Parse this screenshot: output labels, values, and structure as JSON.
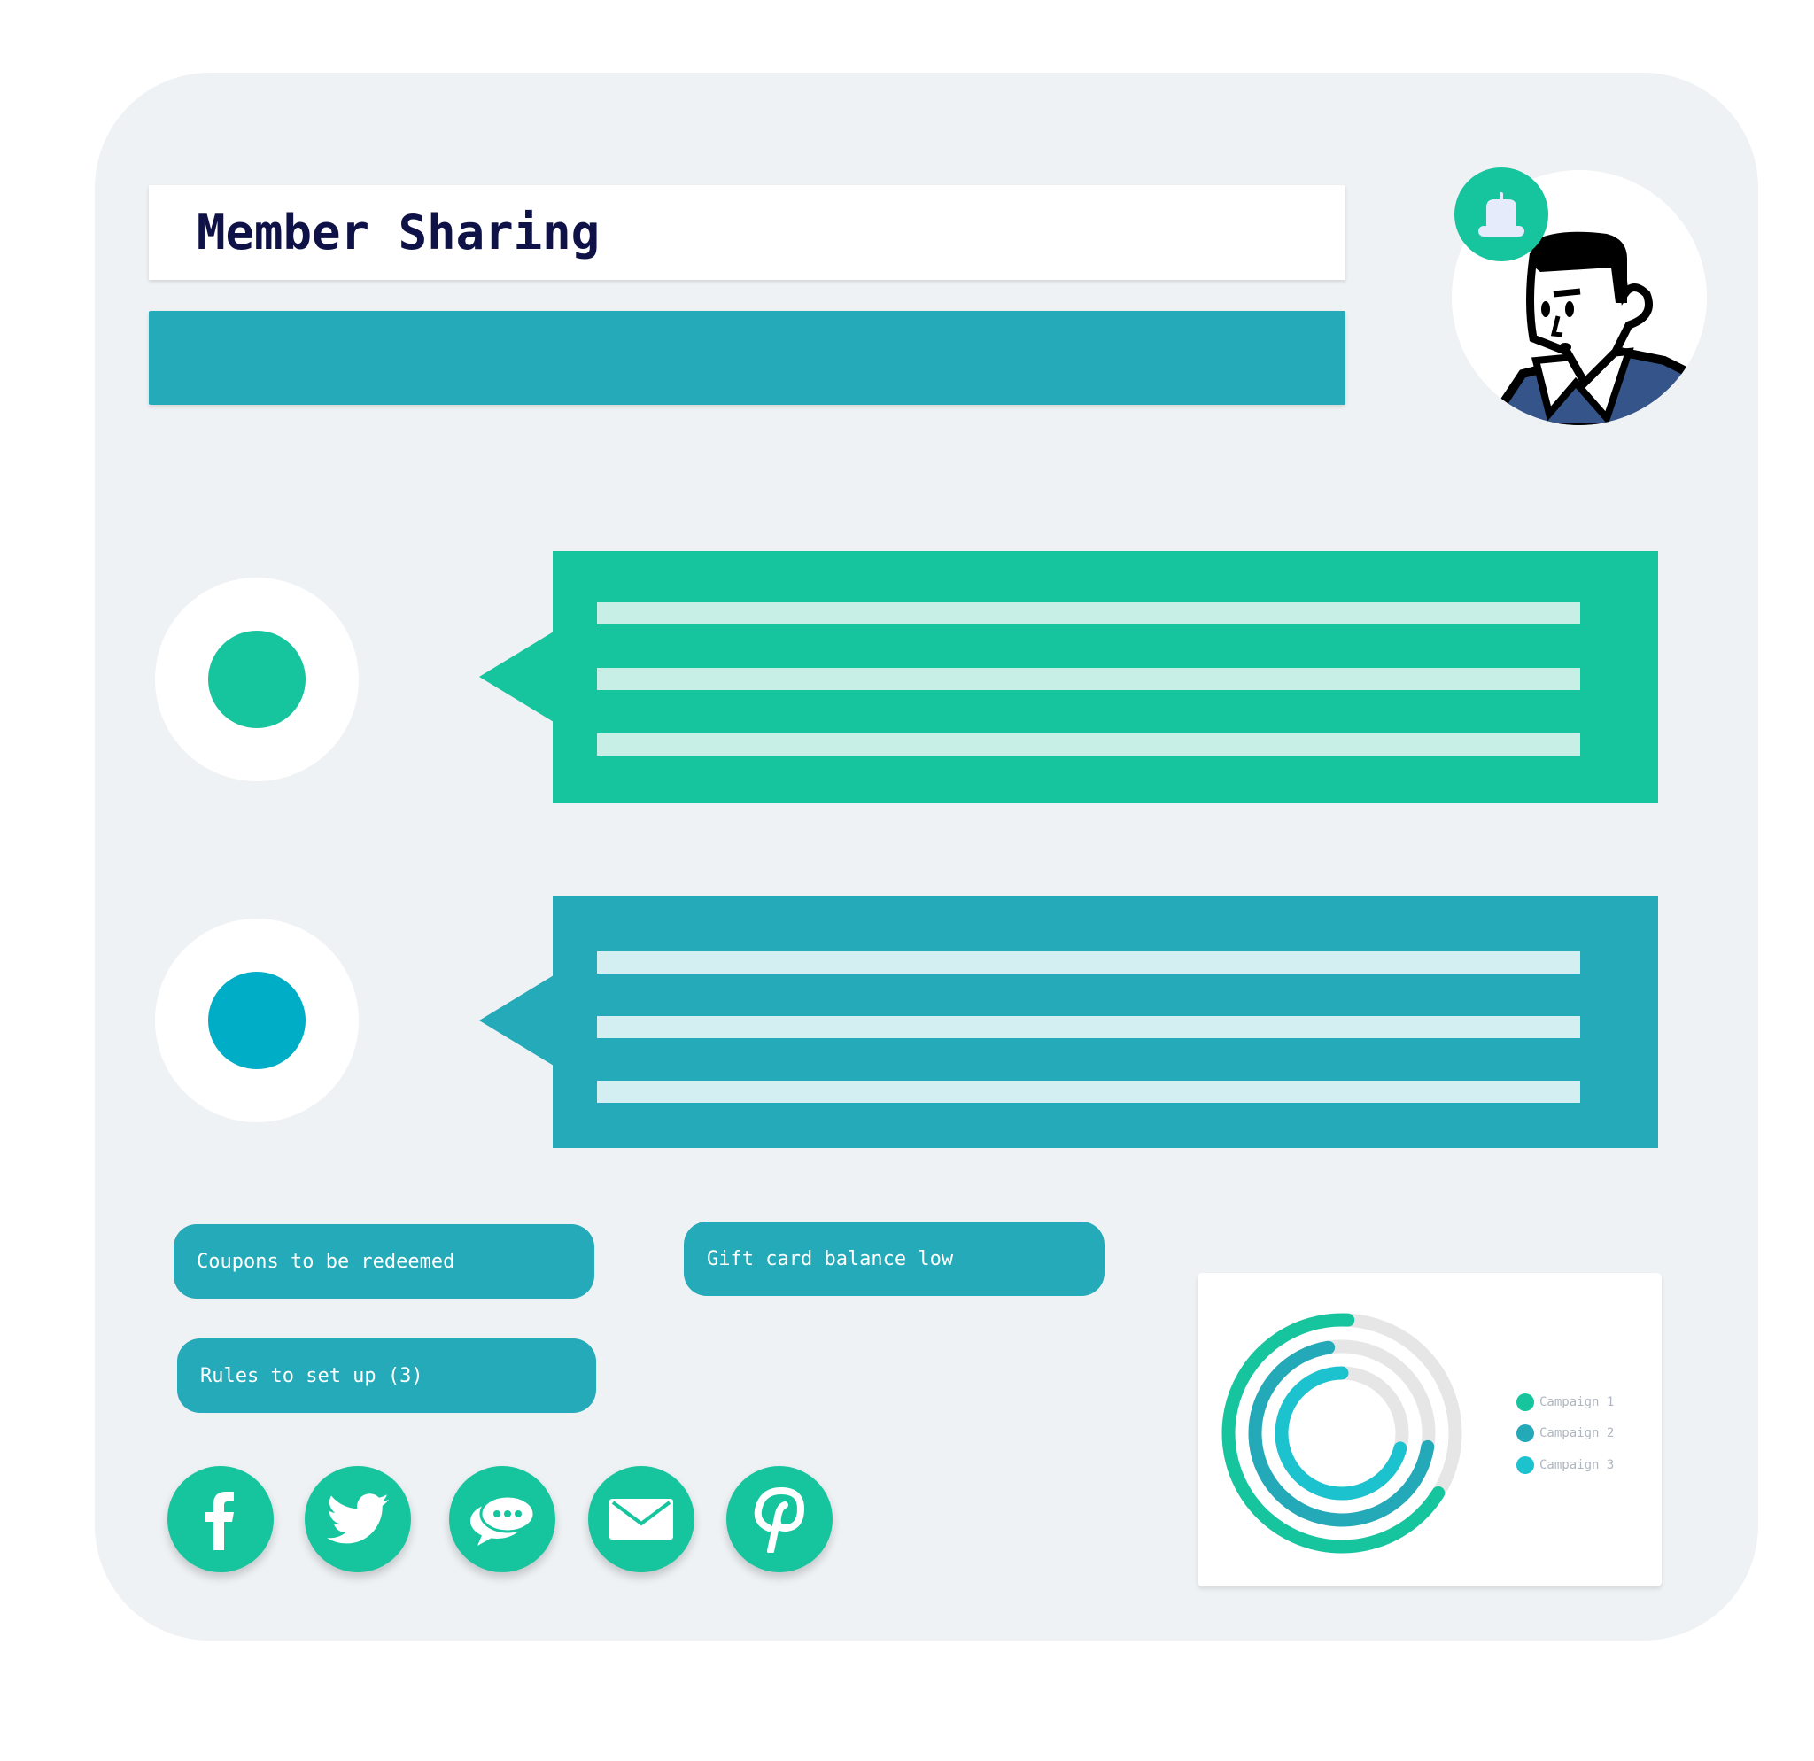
{
  "header": {
    "title": "Member Sharing"
  },
  "notification": {
    "icon": "bell-icon"
  },
  "avatar": {
    "icon": "user-avatar-illustration"
  },
  "messages": [
    {
      "color": "#16c59e",
      "dot_color": "#16c59e",
      "line_color": "#c8efe5"
    },
    {
      "color": "#24aab8",
      "dot_color": "#00adc6",
      "line_color": "#d4eff2"
    }
  ],
  "buttons": {
    "coupons": "Coupons to be redeemed",
    "gift_card": "Gift card balance low",
    "rules": "Rules to set up (3)"
  },
  "social": [
    {
      "name": "facebook",
      "icon": "facebook-icon"
    },
    {
      "name": "twitter",
      "icon": "twitter-icon"
    },
    {
      "name": "chat",
      "icon": "chat-icon"
    },
    {
      "name": "email",
      "icon": "email-icon"
    },
    {
      "name": "pinterest",
      "icon": "pinterest-icon"
    }
  ],
  "colors": {
    "primary_green": "#16c59e",
    "primary_teal": "#24aab8",
    "title": "#0f1246",
    "panel": "#eef2f4"
  },
  "chart_data": {
    "type": "radial-progress",
    "series": [
      {
        "name": "Campaign 1",
        "value": 67,
        "color": "#16c59e"
      },
      {
        "name": "Campaign 2",
        "value": 70,
        "color": "#23a9b7"
      },
      {
        "name": "Campaign 3",
        "value": 71,
        "color": "#1cc2ce"
      }
    ],
    "max": 100,
    "legend": "right"
  }
}
